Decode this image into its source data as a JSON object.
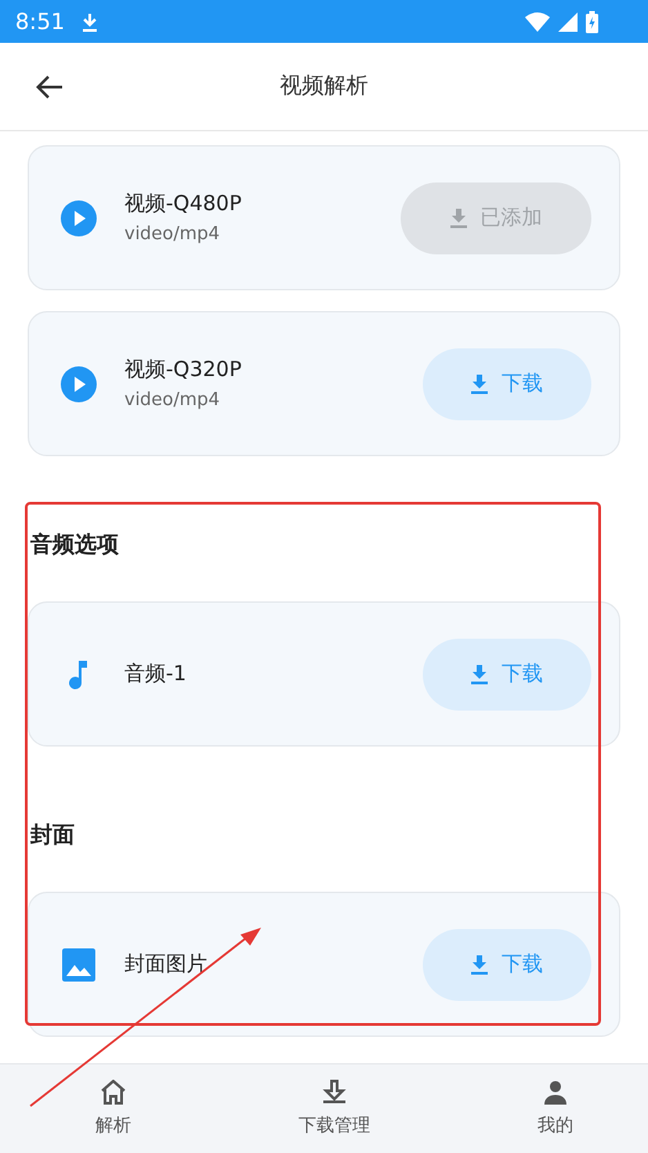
{
  "status_bar": {
    "time": "8:51"
  },
  "app_bar": {
    "title": "视频解析"
  },
  "sections": [
    {
      "items": [
        {
          "kind": "video",
          "title": "视频-Q480P",
          "subtitle": "video/mp4",
          "button": {
            "label": "已添加",
            "disabled": true
          }
        },
        {
          "kind": "video",
          "title": "视频-Q320P",
          "subtitle": "video/mp4",
          "button": {
            "label": "下载",
            "disabled": false
          }
        }
      ]
    },
    {
      "heading": "音频选项",
      "items": [
        {
          "kind": "audio",
          "title": "音频-1",
          "button": {
            "label": "下载",
            "disabled": false
          }
        }
      ]
    },
    {
      "heading": "封面",
      "items": [
        {
          "kind": "image",
          "title": "封面图片",
          "button": {
            "label": "下载",
            "disabled": false
          }
        }
      ]
    }
  ],
  "bottom_nav": [
    {
      "kind": "home",
      "label": "解析"
    },
    {
      "kind": "download",
      "label": "下载管理"
    },
    {
      "kind": "person",
      "label": "我的"
    }
  ]
}
